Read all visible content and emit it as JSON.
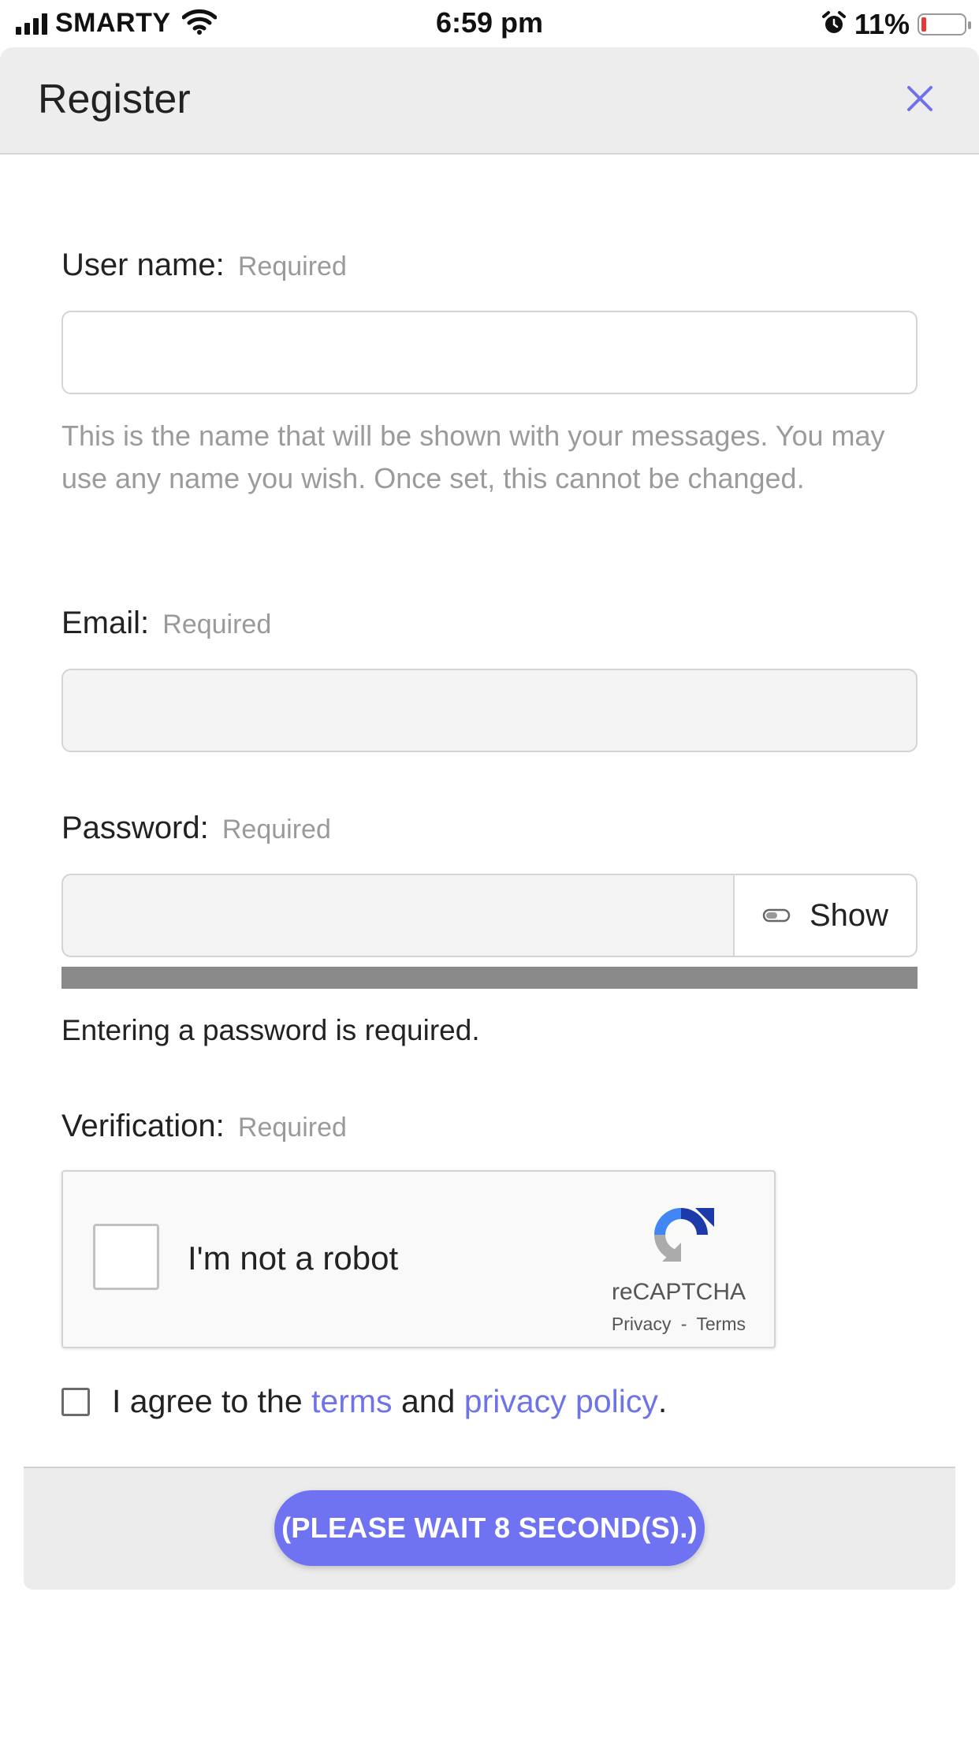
{
  "status_bar": {
    "carrier": "SMARTY",
    "time": "6:59 pm",
    "battery": "11%"
  },
  "modal": {
    "title": "Register",
    "close_icon": "close-icon",
    "accent_color": "#6f73f1"
  },
  "form": {
    "username": {
      "label": "User name:",
      "required": "Required",
      "value": "",
      "hint": "This is the name that will be shown with your messages. You may use any name you wish. Once set, this cannot be changed."
    },
    "email": {
      "label": "Email:",
      "required": "Required",
      "value": ""
    },
    "password": {
      "label": "Password:",
      "required": "Required",
      "value": "",
      "show_label": "Show",
      "show_icon": "eye-toggle-icon",
      "message": "Entering a password is required."
    },
    "verification": {
      "label": "Verification:",
      "required": "Required",
      "captcha_label": "I'm not a robot",
      "brand": "reCAPTCHA",
      "privacy": "Privacy",
      "separator": "-",
      "terms": "Terms"
    },
    "agree": {
      "prefix": "I agree to the",
      "terms_link": "terms",
      "middle": "and",
      "privacy_link": "privacy policy",
      "suffix": "."
    },
    "submit_label": "(PLEASE WAIT 8 SECOND(S).)"
  }
}
